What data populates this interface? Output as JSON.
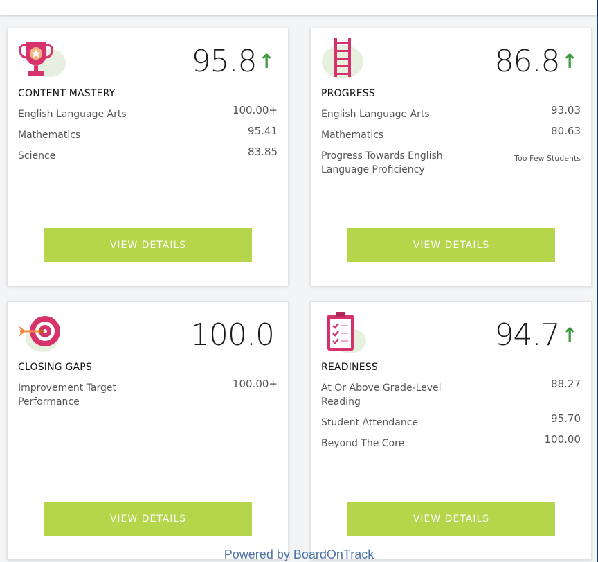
{
  "colors": {
    "accent_green": "#b5d54a",
    "arrow_green": "#3e9a3e",
    "icon_pink": "#d6336c",
    "icon_blob": "#e7f0df",
    "footer_blue": "#4d73a6"
  },
  "cards": [
    {
      "title": "CONTENT MASTERY",
      "score": "95.8",
      "trend_icon": "arrow-up-icon",
      "arrow": "↑",
      "icon": "trophy-icon",
      "metrics": [
        {
          "label": "English Language Arts",
          "value": "100.00+"
        },
        {
          "label": "Mathematics",
          "value": "95.41"
        },
        {
          "label": "Science",
          "value": "83.85"
        }
      ],
      "button": "VIEW DETAILS"
    },
    {
      "title": "PROGRESS",
      "score": "86.8",
      "trend_icon": "arrow-up-icon",
      "arrow": "↑",
      "icon": "ladder-icon",
      "metrics": [
        {
          "label": "English Language Arts",
          "value": "93.03"
        },
        {
          "label": "Mathematics",
          "value": "80.63"
        },
        {
          "label": "Progress Towards English Language Proficiency",
          "value": "Too Few Students"
        }
      ],
      "button": "VIEW DETAILS"
    },
    {
      "title": "CLOSING GAPS",
      "score": "100.0",
      "icon": "target-icon",
      "metrics": [
        {
          "label": "Improvement Target Performance",
          "value": "100.00+"
        }
      ],
      "button": "VIEW DETAILS"
    },
    {
      "title": "READINESS",
      "score": "94.7",
      "trend_icon": "arrow-up-icon",
      "arrow": "↑",
      "icon": "clipboard-icon",
      "metrics": [
        {
          "label": "At Or Above Grade-Level Reading",
          "value": "88.27"
        },
        {
          "label": "Student Attendance",
          "value": "95.70"
        },
        {
          "label": "Beyond The Core",
          "value": "100.00"
        }
      ],
      "button": "VIEW DETAILS"
    }
  ],
  "footer": "Powered by BoardOnTrack"
}
